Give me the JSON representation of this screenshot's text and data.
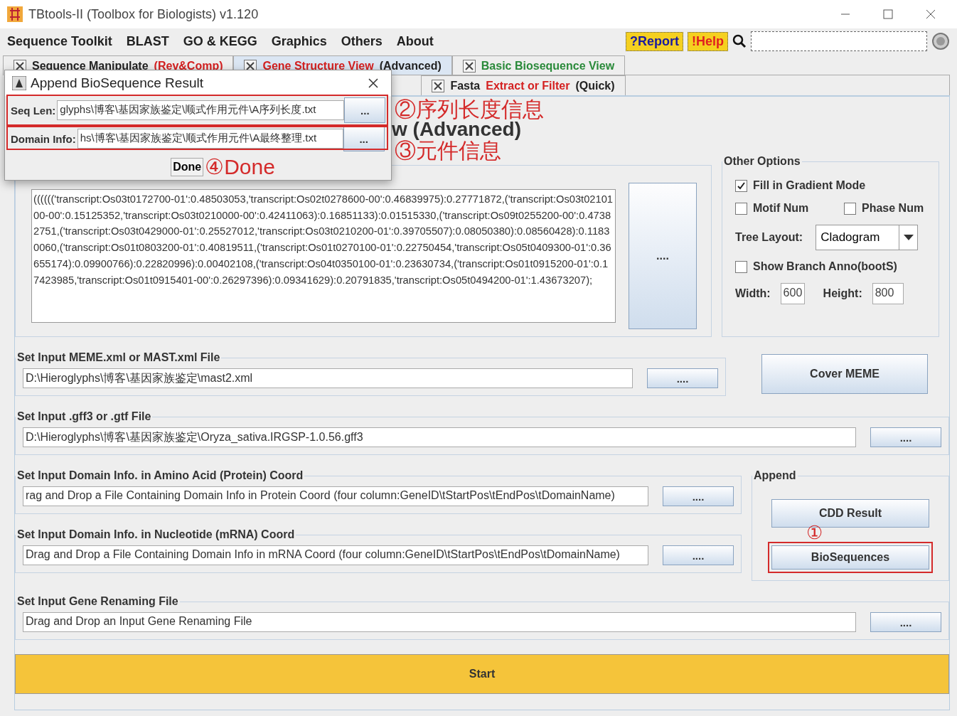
{
  "window": {
    "title": "TBtools-II (Toolbox for Biologists) v1.120"
  },
  "menu": [
    "Sequence Toolkit",
    "BLAST",
    "GO & KEGG",
    "Graphics",
    "Others",
    "About"
  ],
  "menu_buttons": [
    {
      "label": "?Report",
      "kind": "report"
    },
    {
      "label": "!Help",
      "kind": "help"
    }
  ],
  "tabs": [
    {
      "selected": false,
      "parts": [
        {
          "text": "Sequence Manipulate ",
          "color": "#222222"
        },
        {
          "text": "(Rev&Comp)",
          "color": "#d42020"
        }
      ]
    },
    {
      "selected": true,
      "parts": [
        {
          "text": "Gene Structure View ",
          "color": "#d42020"
        },
        {
          "text": "(Advanced)",
          "color": "#222222"
        }
      ]
    },
    {
      "selected": false,
      "parts": [
        {
          "text": "Basic Biosequence View",
          "color": "#2a8a3a"
        }
      ]
    }
  ],
  "subtabs": [
    {
      "selected": false,
      "parts": [
        {
          "text": "Fasta ",
          "color": "#222222"
        },
        {
          "text": "Extract or Filter",
          "color": "#d42020"
        },
        {
          "text": " (Quick)",
          "color": "#222222"
        }
      ]
    }
  ],
  "heading": "w (Advanced)",
  "tree": {
    "text": "(((((('transcript:Os03t0172700-01':0.48503053,'transcript:Os02t0278600-00':0.46839975):0.27771872,('transcript:Os03t0210100-00':0.15125352,'transcript:Os03t0210000-00':0.42411063):0.16851133):0.01515330,('transcript:Os09t0255200-00':0.47382751,('transcript:Os03t0429000-01':0.25527012,'transcript:Os03t0210200-01':0.39705507):0.08050380):0.08560428):0.11830060,('transcript:Os01t0803200-01':0.40819511,('transcript:Os01t0270100-01':0.22750454,'transcript:Os05t0409300-01':0.36655174):0.09900766):0.22820996):0.00402108,('transcript:Os04t0350100-01':0.23630734,('transcript:Os01t0915200-01':0.17423985,'transcript:Os01t0915401-00':0.26297396):0.09341629):0.20791835,'transcript:Os05t0494200-01':1.43673207);",
    "button": "...."
  },
  "other_options": {
    "title": "Other Options",
    "items": [
      {
        "kind": "check",
        "label": "Fill in Gradient Mode",
        "checked": true
      },
      {
        "kind": "check",
        "label": "Motif Num",
        "checked": false
      },
      {
        "kind": "check",
        "label": "Phase Num",
        "checked": false
      }
    ],
    "tree_layout": {
      "label": "Tree Layout:",
      "value": "Cladogram"
    },
    "branch": {
      "label": "Show Branch Anno(bootS)",
      "checked": false
    },
    "width": {
      "label": "Width:",
      "value": "600"
    },
    "height": {
      "label": "Height:",
      "value": "800"
    }
  },
  "meme": {
    "title": "Set Input MEME.xml or MAST.xml File",
    "value": "D:\\Hieroglyphs\\博客\\基因家族鉴定\\mast2.xml",
    "button": "....",
    "side_button": "Cover MEME"
  },
  "gff": {
    "title": "Set Input .gff3 or .gtf File",
    "value": "D:\\Hieroglyphs\\博客\\基因家族鉴定\\Oryza_sativa.IRGSP-1.0.56.gff3",
    "button": "...."
  },
  "protein": {
    "title": "Set Input Domain Info. in Amino Acid (Protein) Coord",
    "value": "rag and Drop a File Containing Domain Info in Protein Coord (four column:GeneID\\tStartPos\\tEndPos\\tDomainName)",
    "button": "...."
  },
  "mrna": {
    "title": "Set Input Domain Info. in Nucleotide (mRNA) Coord",
    "value": "Drag and Drop a File Containing Domain Info in mRNA Coord (four column:GeneID\\tStartPos\\tEndPos\\tDomainName)",
    "button": "...."
  },
  "append": {
    "title": "Append",
    "buttons": [
      "CDD Result",
      "BioSequences"
    ],
    "note": "①"
  },
  "renaming": {
    "title": "Set Input Gene Renaming File",
    "value": "Drag and Drop an Input Gene Renaming File",
    "button": "...."
  },
  "start": "Start",
  "dialog": {
    "title": "Append BioSequence Result",
    "fields": [
      {
        "label": "Seq Len:",
        "value": "glyphs\\博客\\基因家族鉴定\\顺式作用元件\\A序列长度.txt",
        "button": "...",
        "note": "②序列长度信息"
      },
      {
        "label": "Domain Info:",
        "value": "hs\\博客\\基因家族鉴定\\顺式作用元件\\A最终整理.txt",
        "button": "...",
        "note": "③元件信息"
      }
    ],
    "done": "Done",
    "done_note": "④Done"
  }
}
